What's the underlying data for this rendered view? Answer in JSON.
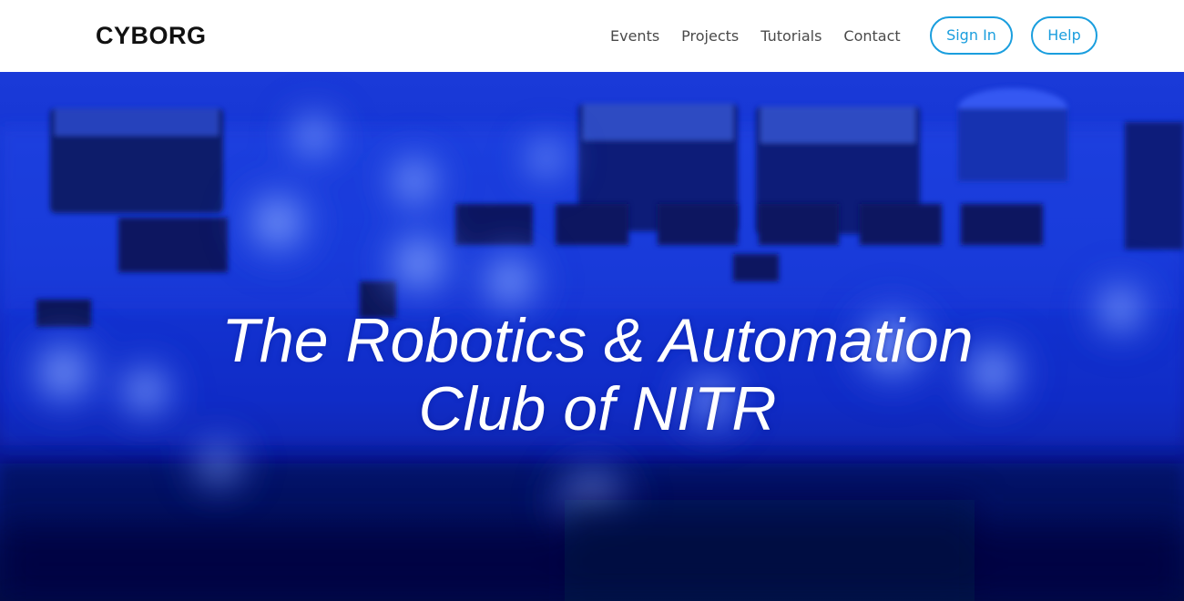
{
  "navbar": {
    "brand": "CYBORG",
    "links": [
      {
        "label": "Events"
      },
      {
        "label": "Projects"
      },
      {
        "label": "Tutorials"
      },
      {
        "label": "Contact"
      }
    ],
    "signin_label": "Sign In",
    "help_label": "Help"
  },
  "hero": {
    "title_line1": "The Robotics & Automation",
    "title_line2": "Club of NITR",
    "background_image": "blurred blue circuit board"
  },
  "colors": {
    "accent": "#1a9ede",
    "nav_text": "#4a4a4a",
    "brand_text": "#111111",
    "hero_base": "#061570",
    "hero_title": "#ffffff"
  }
}
